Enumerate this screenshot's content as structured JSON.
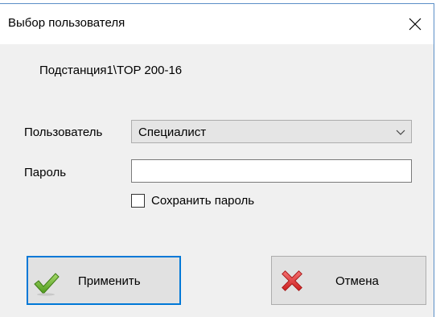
{
  "window": {
    "title": "Выбор пользователя",
    "close_icon": "close-icon"
  },
  "path": "Подстанция1\\TOP 200-16",
  "form": {
    "user_label": "Пользователь",
    "user_value": "Специалист",
    "password_label": "Пароль",
    "password_value": "",
    "save_password_label": "Сохранить пароль",
    "save_password_checked": false
  },
  "buttons": {
    "apply_label": "Применить",
    "apply_icon": "checkmark-icon",
    "cancel_label": "Отмена",
    "cancel_icon": "cross-icon"
  },
  "colors": {
    "focus_border": "#0078d7",
    "window_border": "#5b8fc7",
    "check_green": "#6cb52e",
    "cross_red": "#e23a3a"
  }
}
